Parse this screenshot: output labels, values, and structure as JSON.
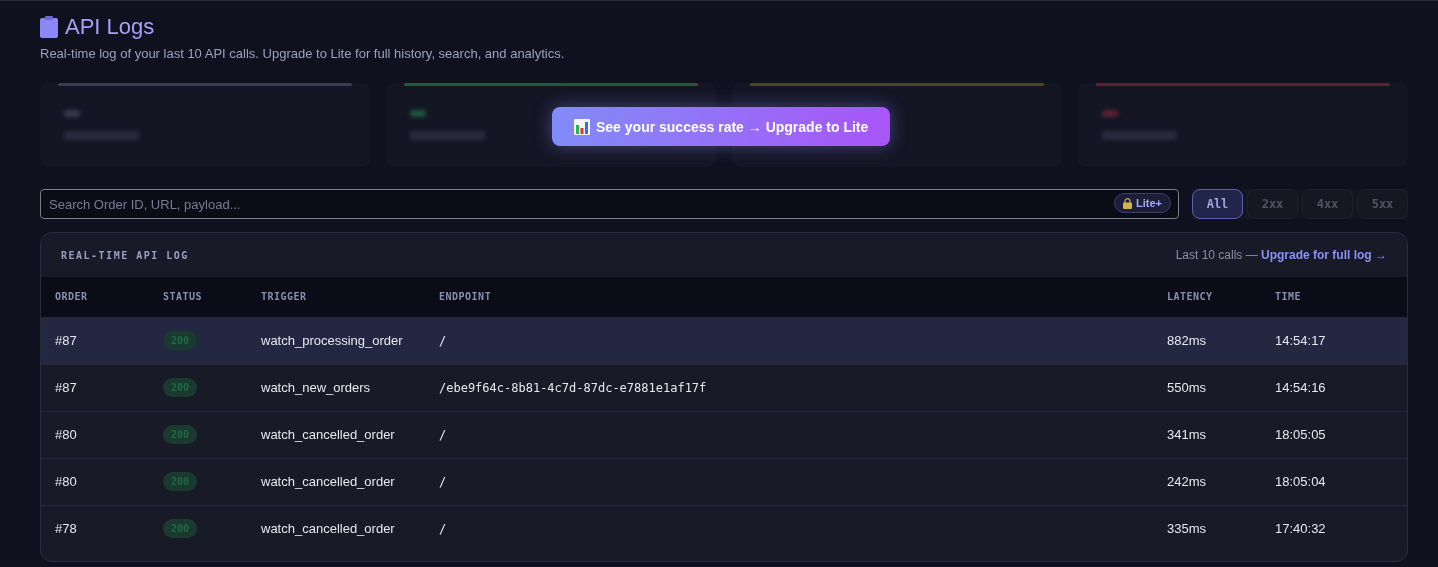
{
  "header": {
    "title": "API Logs",
    "subtitle": "Real-time log of your last 10 API calls. Upgrade to Lite for full history, search, and analytics."
  },
  "stat_cards": [
    {
      "color": "#3a3c52"
    },
    {
      "color": "#1f5a3c"
    },
    {
      "color": "#5a4022"
    },
    {
      "color": "#5a2234"
    }
  ],
  "upgrade_banner": {
    "label": "See your success rate → Upgrade to Lite"
  },
  "search": {
    "placeholder": "Search Order ID, URL, payload...",
    "badge": "Lite+"
  },
  "filters": [
    {
      "label": "All",
      "selected": true
    },
    {
      "label": "2xx",
      "selected": false
    },
    {
      "label": "4xx",
      "selected": false
    },
    {
      "label": "5xx",
      "selected": false
    }
  ],
  "log": {
    "title": "REAL-TIME API LOG",
    "note": "Last 10 calls —",
    "link": "Upgrade for full log →",
    "columns": [
      "ORDER",
      "STATUS",
      "TRIGGER",
      "ENDPOINT",
      "LATENCY",
      "TIME"
    ],
    "rows": [
      {
        "order": "#87",
        "status": "200",
        "trigger": "watch_processing_order",
        "endpoint": "/",
        "latency": "882ms",
        "time": "14:54:17",
        "selected": true
      },
      {
        "order": "#87",
        "status": "200",
        "trigger": "watch_new_orders",
        "endpoint": "/ebe9f64c-8b81-4c7d-87dc-e7881e1af17f",
        "latency": "550ms",
        "time": "14:54:16",
        "selected": false
      },
      {
        "order": "#80",
        "status": "200",
        "trigger": "watch_cancelled_order",
        "endpoint": "/",
        "latency": "341ms",
        "time": "18:05:05",
        "selected": false
      },
      {
        "order": "#80",
        "status": "200",
        "trigger": "watch_cancelled_order",
        "endpoint": "/",
        "latency": "242ms",
        "time": "18:05:04",
        "selected": false
      },
      {
        "order": "#78",
        "status": "200",
        "trigger": "watch_cancelled_order",
        "endpoint": "/",
        "latency": "335ms",
        "time": "17:40:32",
        "selected": false
      }
    ]
  }
}
